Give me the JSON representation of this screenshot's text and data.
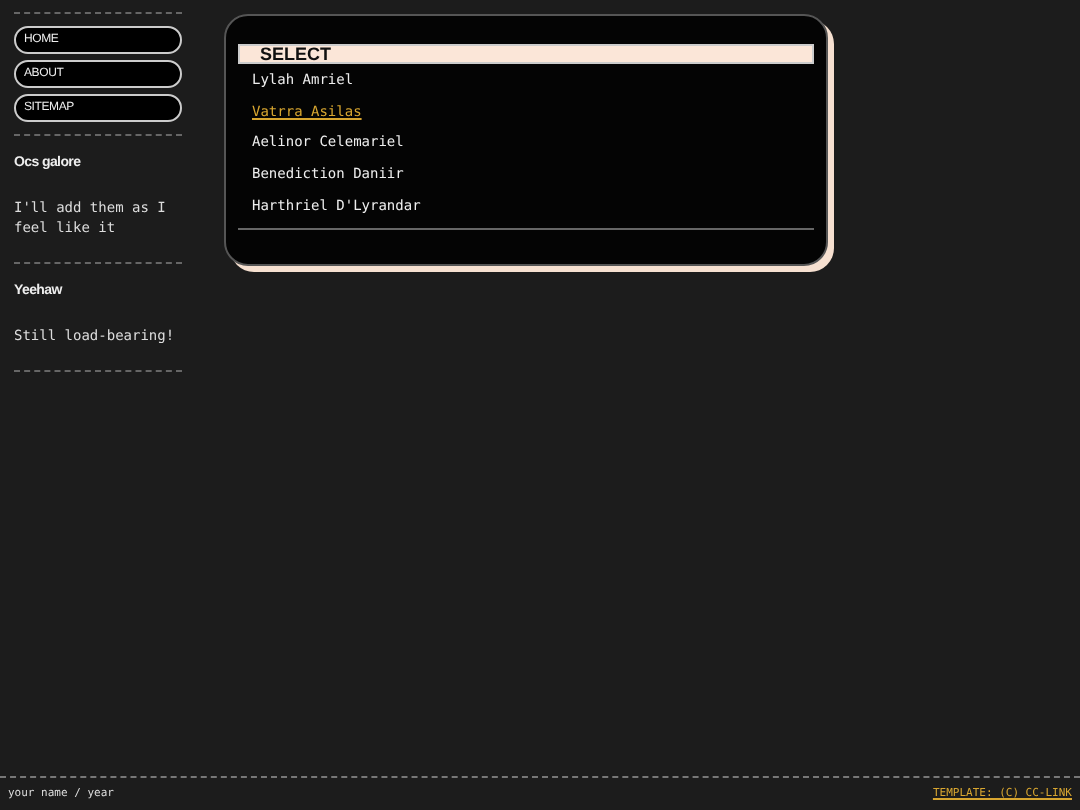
{
  "nav": [
    {
      "label": "HOME"
    },
    {
      "label": "ABOUT"
    },
    {
      "label": "SITEMAP"
    }
  ],
  "sidebar_sections": [
    {
      "heading": "Ocs galore",
      "text": "I'll add them as I feel like it"
    },
    {
      "heading": "Yeehaw",
      "text": "Still load-bearing!"
    }
  ],
  "panel": {
    "title": "SELECT",
    "items": [
      {
        "label": "Lylah Amriel",
        "selected": false
      },
      {
        "label": "Vatrra Asilas",
        "selected": true
      },
      {
        "label": "Aelinor Celemariel",
        "selected": false
      },
      {
        "label": "Benediction Daniir",
        "selected": false
      },
      {
        "label": "Harthriel D'Lyrandar",
        "selected": false
      }
    ]
  },
  "footer": {
    "left": "your name / year",
    "link": "TEMPLATE: (C) CC-LINK"
  }
}
